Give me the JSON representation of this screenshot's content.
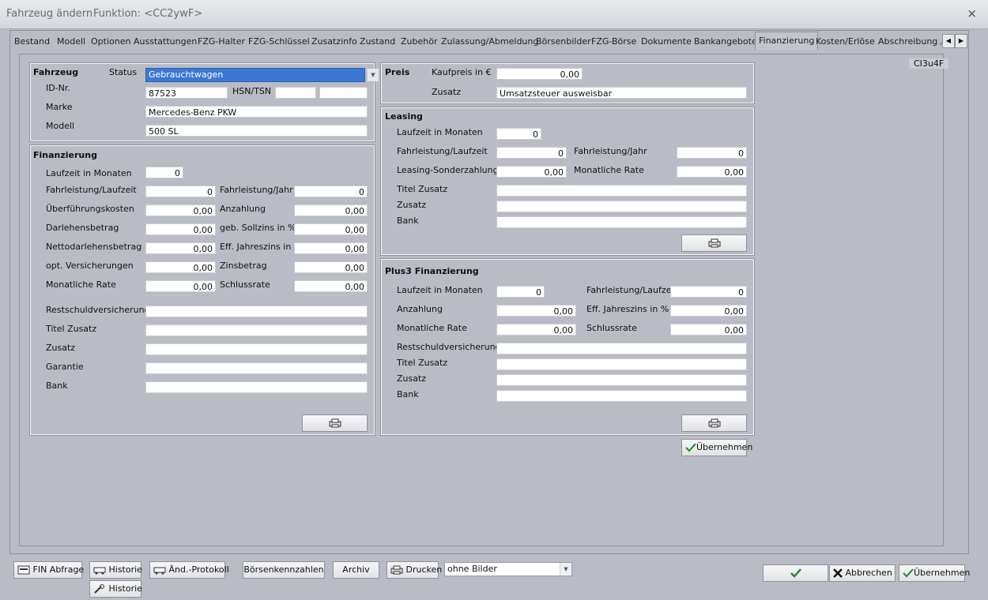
{
  "window": {
    "title": "Fahrzeug ändern",
    "function_label": "Funktion: <CC2ywF>",
    "close": "×"
  },
  "tabs": [
    "Bestand",
    "Modell",
    "Optionen",
    "Ausstattungen",
    "FZG-Halter",
    "FZG-Schlüssel",
    "Zusatzinfo",
    "Zustand",
    "Zubehör",
    "Zulassung/Abmeldung",
    "Börsenbilder",
    "FZG-Börse",
    "Dokumente",
    "Bankangebote",
    "Finanzierung",
    "Kosten/Erlöse",
    "Abschreibung / V"
  ],
  "active_tab": "Finanzierung",
  "code_badge": "CI3u4F",
  "fahrzeug": {
    "title": "Fahrzeug",
    "status_label": "Status",
    "status_value": "Gebrauchtwagen",
    "id_label": "ID-Nr.",
    "id_value": "87523",
    "hsn_label": "HSN/TSN",
    "hsn_value": "",
    "tsn_value": "",
    "marke_label": "Marke",
    "marke_value": "Mercedes-Benz PKW",
    "modell_label": "Modell",
    "modell_value": "500 SL"
  },
  "finanzierung": {
    "title": "Finanzierung",
    "laufzeit_label": "Laufzeit in Monaten",
    "laufzeit_value": "0",
    "fahrleistung_laufzeit_label": "Fahrleistung/Laufzeit",
    "fahrleistung_laufzeit_value": "0",
    "fahrleistung_jahr_label": "Fahrleistung/Jahr",
    "fahrleistung_jahr_value": "0",
    "ueberfuehrung_label": "Überführungskosten",
    "ueberfuehrung_value": "0,00",
    "anzahlung_label": "Anzahlung",
    "anzahlung_value": "0,00",
    "darlehen_label": "Darlehensbetrag",
    "darlehen_value": "0,00",
    "sollzins_label": "geb. Sollzins in %",
    "sollzins_value": "0,00",
    "netto_label": "Nettodarlehensbetrag",
    "netto_value": "0,00",
    "eff_label": "Eff. Jahreszins in %",
    "eff_value": "0,00",
    "versicherung_label": "opt. Versicherungen",
    "versicherung_value": "0,00",
    "zinsbetrag_label": "Zinsbetrag",
    "zinsbetrag_value": "0,00",
    "rate_label": "Monatliche Rate",
    "rate_value": "0,00",
    "schlussrate_label": "Schlussrate",
    "schlussrate_value": "0,00",
    "restschuld_label": "Restschuldversicherung",
    "restschuld_value": "",
    "titel_label": "Titel Zusatz",
    "titel_value": "",
    "zusatz_label": "Zusatz",
    "zusatz_value": "",
    "garantie_label": "Garantie",
    "garantie_value": "",
    "bank_label": "Bank",
    "bank_value": ""
  },
  "preis": {
    "title": "Preis",
    "kaufpreis_label": "Kaufpreis in €",
    "kaufpreis_value": "0,00",
    "zusatz_label": "Zusatz",
    "zusatz_value": "Umsatzsteuer ausweisbar"
  },
  "leasing": {
    "title": "Leasing",
    "laufzeit_label": "Laufzeit in Monaten",
    "laufzeit_value": "0",
    "fahrleistung_laufzeit_label": "Fahrleistung/Laufzeit",
    "fahrleistung_laufzeit_value": "0",
    "fahrleistung_jahr_label": "Fahrleistung/Jahr",
    "fahrleistung_jahr_value": "0",
    "sonderzahlung_label": "Leasing-Sonderzahlung",
    "sonderzahlung_value": "0,00",
    "rate_label": "Monatliche Rate",
    "rate_value": "0,00",
    "titel_label": "Titel Zusatz",
    "titel_value": "",
    "zusatz_label": "Zusatz",
    "zusatz_value": "",
    "bank_label": "Bank",
    "bank_value": ""
  },
  "plus3": {
    "title": "Plus3 Finanzierung",
    "laufzeit_label": "Laufzeit in Monaten",
    "laufzeit_value": "0",
    "fahrleistung_label": "Fahrleistung/Laufzeit",
    "fahrleistung_value": "0",
    "anzahlung_label": "Anzahlung",
    "anzahlung_value": "0,00",
    "eff_label": "Eff. Jahreszins in %",
    "eff_value": "0,00",
    "rate_label": "Monatliche Rate",
    "rate_value": "0,00",
    "schlussrate_label": "Schlussrate",
    "schlussrate_value": "0,00",
    "restschuld_label": "Restschuldversicherung",
    "restschuld_value": "",
    "titel_label": "Titel Zusatz",
    "titel_value": "",
    "zusatz_label": "Zusatz",
    "zusatz_value": "",
    "bank_label": "Bank",
    "bank_value": ""
  },
  "uebernehmen_inner": "Übernehmen",
  "footer": {
    "fin_abfrage": "FIN Abfrage",
    "historie": "Historie",
    "historie2": "Historie",
    "aend_protokoll": "Änd.-Protokoll",
    "boersenkennzahlen": "Börsenkennzahlen",
    "archiv": "Archiv",
    "drucken": "Drucken",
    "print_option": "ohne Bilder",
    "abbrechen": "Abbrechen",
    "uebernehmen": "Übernehmen"
  }
}
